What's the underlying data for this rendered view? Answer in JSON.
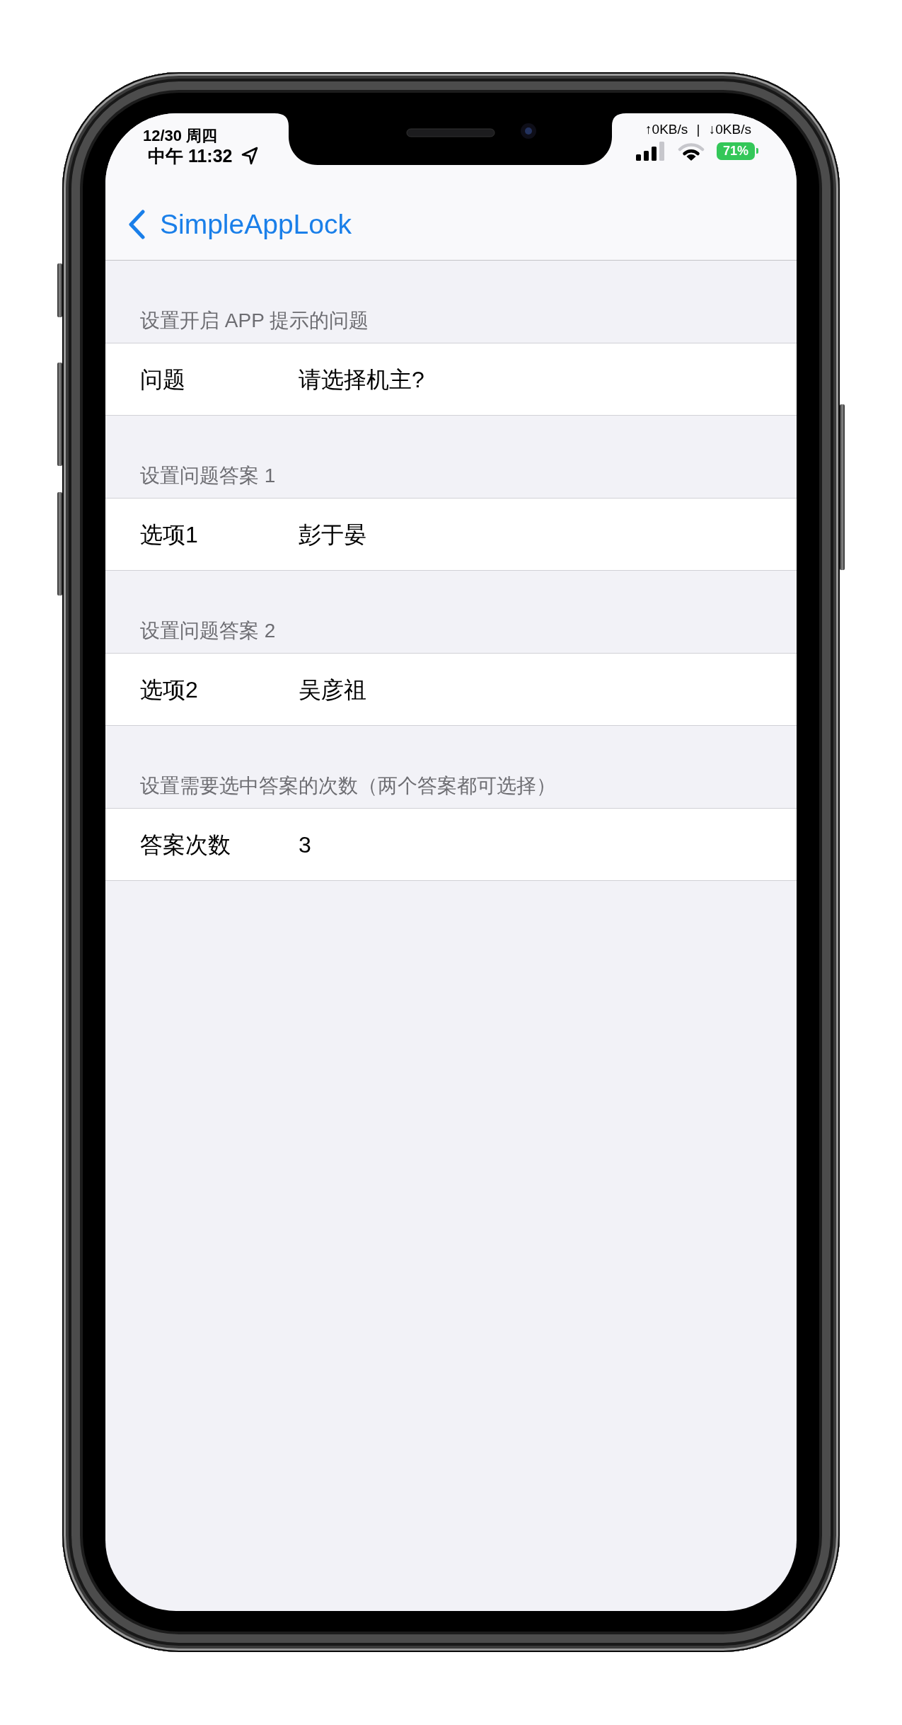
{
  "status_bar": {
    "date": "12/30 周四",
    "time": "中午 11:32",
    "network_speed": "↑0KB/s | ↓0KB/s",
    "battery": "71%"
  },
  "nav_bar": {
    "back_label": "SimpleAppLock"
  },
  "sections": [
    {
      "header": "设置开启 APP 提示的问题",
      "rows": [
        {
          "label": "问题",
          "value": "请选择机主?"
        }
      ]
    },
    {
      "header": "设置问题答案 1",
      "rows": [
        {
          "label": "选项1",
          "value": "彭于晏"
        }
      ]
    },
    {
      "header": "设置问题答案 2",
      "rows": [
        {
          "label": "选项2",
          "value": "吴彦祖"
        }
      ]
    },
    {
      "header": "设置需要选中答案的次数（两个答案都可选择）",
      "rows": [
        {
          "label": "答案次数",
          "value": "3"
        }
      ]
    }
  ]
}
